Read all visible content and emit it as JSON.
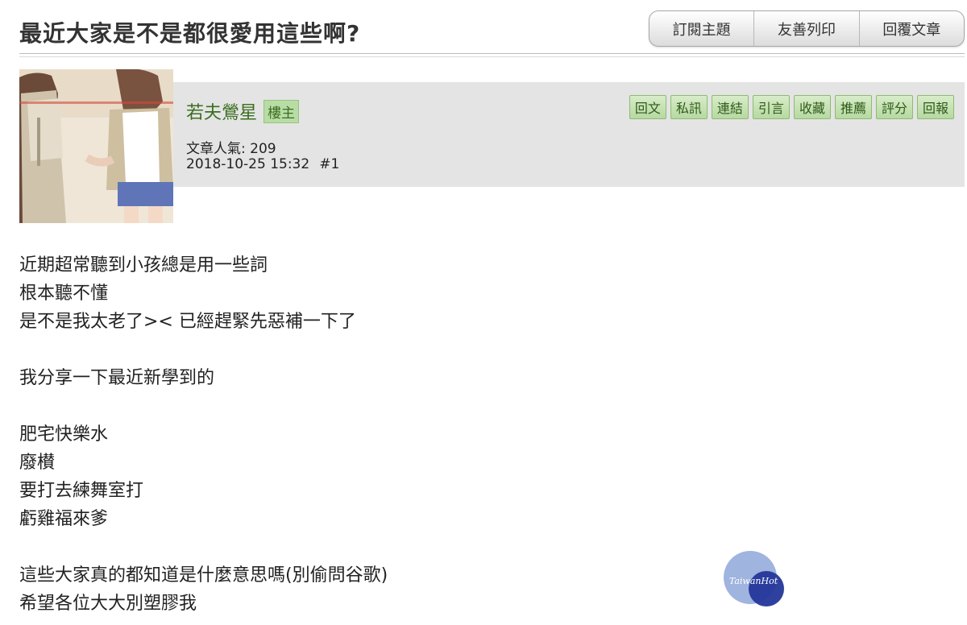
{
  "thread": {
    "title": "最近大家是不是都很愛用這些啊?",
    "buttons": [
      "訂閱主題",
      "友善列印",
      "回覆文章"
    ]
  },
  "post": {
    "author": "若夫鶯星",
    "badge": "樓主",
    "popularity": "文章人氣: 209",
    "date": "2018-10-25 15:32",
    "floor": "#1",
    "actions": [
      "回文",
      "私訊",
      "連結",
      "引言",
      "收藏",
      "推薦",
      "評分",
      "回報"
    ],
    "body": [
      "近期超常聽到小孩總是用一些詞",
      "根本聽不懂",
      "是不是我太老了>< 已經趕緊先惡補一下了",
      "",
      "我分享一下最近新學到的",
      "",
      "肥宅快樂水",
      "廢櫕",
      "要打去練舞室打",
      "虧雞福來爹",
      "",
      "這些大家真的都知道是什麼意思嗎(別偷問谷歌)",
      "希望各位大大別塑膠我"
    ]
  },
  "watermark": {
    "text": "TaiwanHot",
    "colors": {
      "light": "#8ea7d8",
      "dark": "#24379a"
    }
  }
}
